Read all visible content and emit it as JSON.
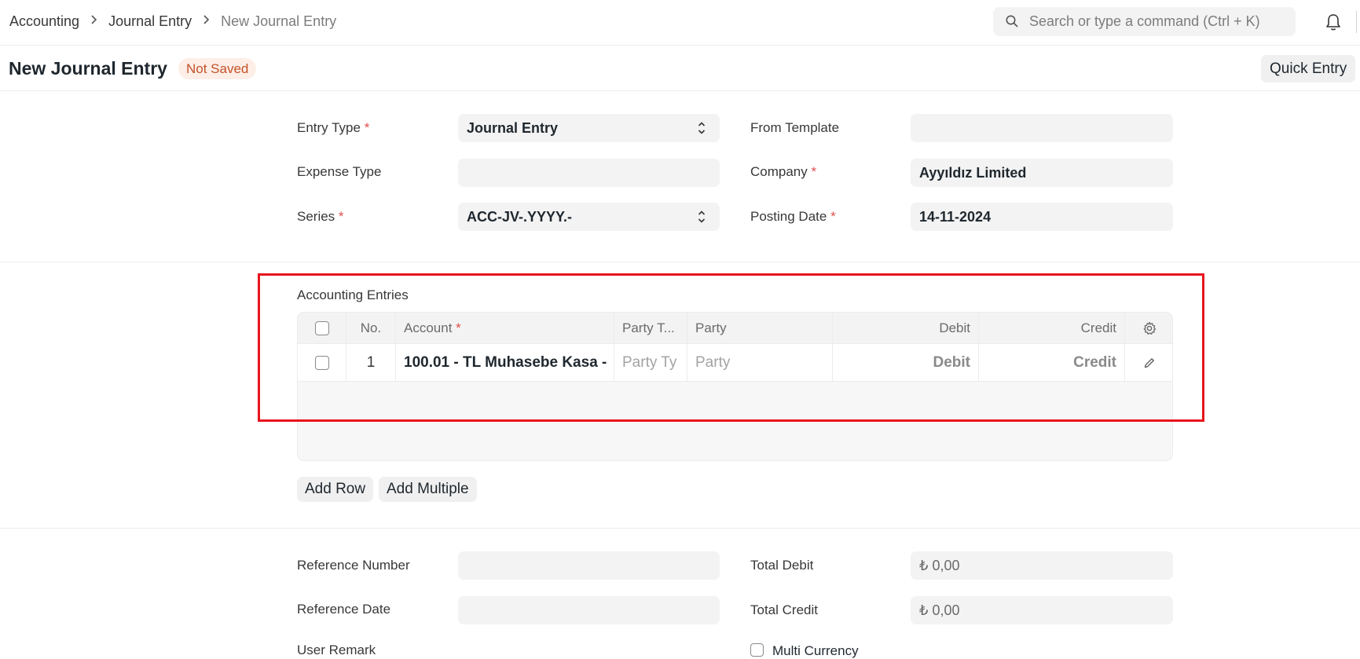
{
  "breadcrumb": {
    "items": [
      "Accounting",
      "Journal Entry",
      "New Journal Entry"
    ]
  },
  "search": {
    "placeholder": "Search or type a command (Ctrl + K)"
  },
  "page": {
    "title": "New Journal Entry",
    "status": "Not Saved",
    "quick_entry_label": "Quick Entry"
  },
  "form": {
    "entry_type": {
      "label": "Entry Type",
      "value": "Journal Entry"
    },
    "from_template": {
      "label": "From Template",
      "value": ""
    },
    "expense_type": {
      "label": "Expense Type",
      "value": ""
    },
    "company": {
      "label": "Company",
      "value": "Ayyıldız Limited"
    },
    "series": {
      "label": "Series",
      "value": "ACC-JV-.YYYY.-"
    },
    "posting_date": {
      "label": "Posting Date",
      "value": "14-11-2024"
    },
    "required_mark": "*"
  },
  "grid": {
    "title": "Accounting Entries",
    "columns": {
      "no": "No.",
      "account": "Account",
      "party_type": "Party T...",
      "party": "Party",
      "debit": "Debit",
      "credit": "Credit"
    },
    "rows": [
      {
        "no": "1",
        "account": "100.01 - TL Muhasebe Kasa -",
        "party_type": "Party Ty",
        "party": "Party",
        "debit": "Debit",
        "credit": "Credit"
      }
    ],
    "add_row_label": "Add Row",
    "add_multiple_label": "Add Multiple"
  },
  "references": {
    "reference_number": {
      "label": "Reference Number",
      "value": ""
    },
    "reference_date": {
      "label": "Reference Date",
      "value": ""
    },
    "user_remark": {
      "label": "User Remark"
    },
    "total_debit": {
      "label": "Total Debit",
      "value": "₺ 0,00"
    },
    "total_credit": {
      "label": "Total Credit",
      "value": "₺ 0,00"
    },
    "multi_currency": {
      "label": "Multi Currency",
      "checked": false
    }
  },
  "colors": {
    "highlight": "#e8141c",
    "badge_text": "#c4522a",
    "badge_bg": "#fdeee7",
    "required": "#e24c4c"
  },
  "icons": [
    "search-icon",
    "bell-icon",
    "chevron-right-icon",
    "select-arrows-icon",
    "gear-icon",
    "pencil-icon",
    "checkbox"
  ]
}
